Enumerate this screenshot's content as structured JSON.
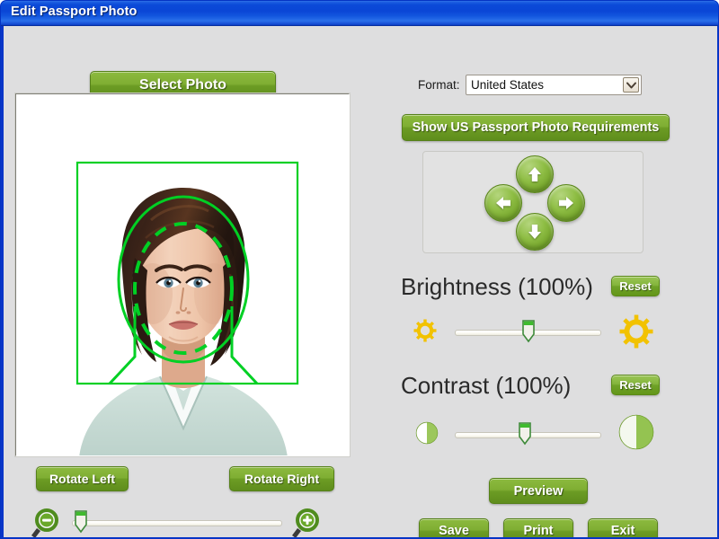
{
  "window": {
    "title": "Edit Passport Photo",
    "frame_color": "#0a46d6",
    "client_bg": "#dededf"
  },
  "left_panel": {
    "select_photo_label": "Select Photo",
    "rotate_left_label": "Rotate Left",
    "rotate_right_label": "Rotate Right",
    "zoom_out_icon": "magnifier-minus-icon",
    "zoom_in_icon": "magnifier-plus-icon",
    "zoom_slider_value": 0,
    "photo": {
      "alt": "passport photo of a young woman with dark bob haircut on white background",
      "guide_color": "#00d024",
      "crop_rect": true,
      "face_oval": true,
      "inner_dashed_oval": true,
      "shoulder_guide": true
    }
  },
  "right_panel": {
    "format": {
      "label": "Format:",
      "selected": "United States",
      "options": [
        "United States"
      ],
      "arrow_icon": "chevron-down-icon"
    },
    "requirements_button_label": "Show US Passport Photo Requirements",
    "arrow_pad": {
      "up": "arrow-up-icon",
      "down": "arrow-down-icon",
      "left": "arrow-left-icon",
      "right": "arrow-right-icon"
    },
    "brightness": {
      "title": "Brightness (100%)",
      "value": 100,
      "reset_label": "Reset",
      "min_icon": "small-sun-icon",
      "max_icon": "large-sun-icon",
      "slider_position_percent": 47
    },
    "contrast": {
      "title": "Contrast (100%)",
      "value": 100,
      "reset_label": "Reset",
      "min_icon": "small-contrast-circle-icon",
      "max_icon": "large-contrast-circle-icon",
      "slider_position_percent": 45
    },
    "preview_label": "Preview",
    "save_label": "Save",
    "print_label": "Print",
    "exit_label": "Exit"
  },
  "colors": {
    "green_button": "#7fae33",
    "green_button_dark": "#5f8d1c",
    "title_blue": "#0a46d6",
    "guide_green": "#00d024",
    "sun_yellow": "#f5c400"
  }
}
